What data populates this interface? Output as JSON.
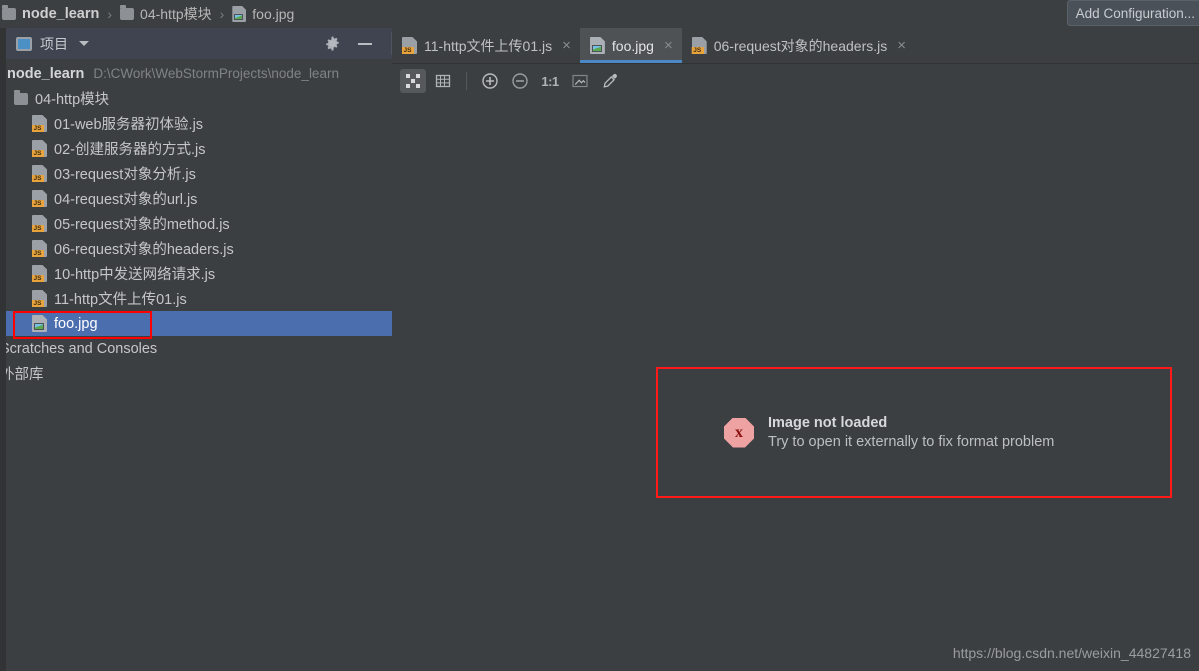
{
  "window": {
    "breadcrumb": [
      {
        "label": "node_learn",
        "icon": "folder-icon"
      },
      {
        "label": "04-http模块",
        "icon": "folder-icon"
      },
      {
        "label": "foo.jpg",
        "icon": "image-file-icon"
      }
    ],
    "separator": "›",
    "add_configuration": "Add Configuration..."
  },
  "project_panel": {
    "title": "项目",
    "gear_icon": "gear-icon",
    "minimize_icon": "minimize-icon",
    "caret_icon": "chevron-down-icon",
    "root": {
      "name": "node_learn",
      "path": "D:\\CWork\\WebStormProjects\\node_learn"
    },
    "folder": "04-http模块",
    "files": [
      {
        "label": "01-web服务器初体验.js",
        "icon": "js-file-icon"
      },
      {
        "label": "02-创建服务器的方式.js",
        "icon": "js-file-icon"
      },
      {
        "label": "03-request对象分析.js",
        "icon": "js-file-icon"
      },
      {
        "label": "04-request对象的url.js",
        "icon": "js-file-icon"
      },
      {
        "label": "05-request对象的method.js",
        "icon": "js-file-icon"
      },
      {
        "label": "06-request对象的headers.js",
        "icon": "js-file-icon"
      },
      {
        "label": "10-http中发送网络请求.js",
        "icon": "js-file-icon"
      },
      {
        "label": "11-http文件上传01.js",
        "icon": "js-file-icon"
      }
    ],
    "selected_file": {
      "label": "foo.jpg",
      "icon": "image-file-icon"
    },
    "extra_nodes": [
      "Scratches and Consoles",
      "外部库"
    ]
  },
  "editor": {
    "tabs": [
      {
        "label": "11-http文件上传01.js",
        "icon": "js-file-icon",
        "active": false,
        "close": "×"
      },
      {
        "label": "foo.jpg",
        "icon": "image-file-icon",
        "active": true,
        "close": "×"
      },
      {
        "label": "06-request对象的headers.js",
        "icon": "js-file-icon",
        "active": false,
        "close": "×"
      }
    ],
    "toolbar": [
      {
        "name": "transparency-grid-icon",
        "active": true
      },
      {
        "name": "pixel-grid-icon",
        "active": false
      },
      {
        "name": "zoom-in-icon",
        "active": false
      },
      {
        "name": "zoom-out-icon",
        "active": false
      },
      {
        "name": "actual-size-icon",
        "label": "1:1",
        "active": false
      },
      {
        "name": "fit-to-window-icon",
        "active": false
      },
      {
        "name": "color-picker-icon",
        "active": false
      }
    ],
    "error": {
      "icon": "error-octagon-icon",
      "icon_glyph": "x",
      "title": "Image not loaded",
      "subtitle": "Try to open it externally to fix format problem"
    }
  },
  "watermark": "https://blog.csdn.net/weixin_44827418",
  "colors": {
    "background": "#3c3f41",
    "panel_header": "#3f4450",
    "selection": "#4b6eaf",
    "annotation": "#ff0000",
    "tab_underline": "#4a88c7",
    "js_badge": "#e8a33d"
  }
}
